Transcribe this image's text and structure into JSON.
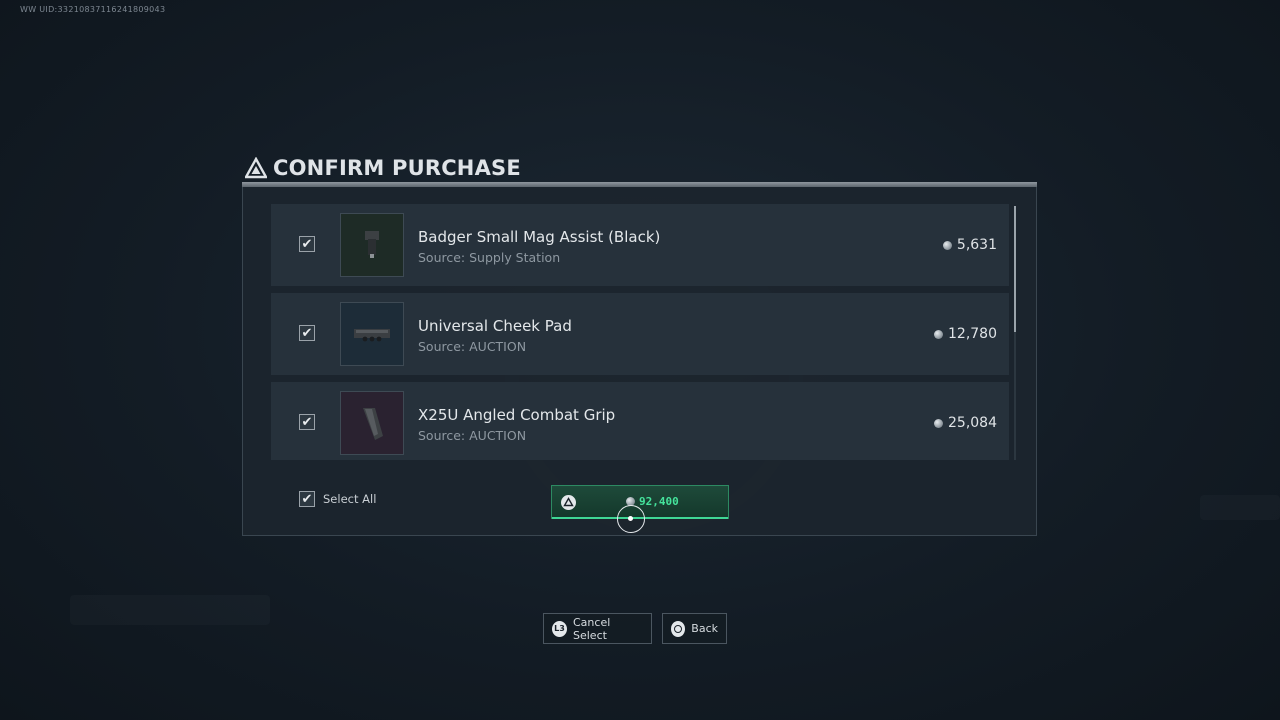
{
  "uid": "WW UID:3321083711624180904​3",
  "dialog": {
    "title": "CONFIRM PURCHASE"
  },
  "items": [
    {
      "name": "Badger Small Mag Assist (Black)",
      "source": "Source: Supply Station",
      "price": "5,631",
      "checked": true,
      "thumb_color": "#1e2b26"
    },
    {
      "name": "Universal Cheek Pad",
      "source": "Source: AUCTION",
      "price": "12,780",
      "checked": true,
      "thumb_color": "#1d2c38"
    },
    {
      "name": "X25U Angled Combat Grip",
      "source": "Source: AUCTION",
      "price": "25,084",
      "checked": true,
      "thumb_color": "#2a2230"
    }
  ],
  "select_all": {
    "label": "Select All",
    "checked": true
  },
  "purchase": {
    "total": "92,400",
    "accent": "#45e39c"
  },
  "hints": {
    "cancel_select": {
      "key": "L3",
      "label": "Cancel Select"
    },
    "back": {
      "key": "circle",
      "label": "Back"
    }
  }
}
